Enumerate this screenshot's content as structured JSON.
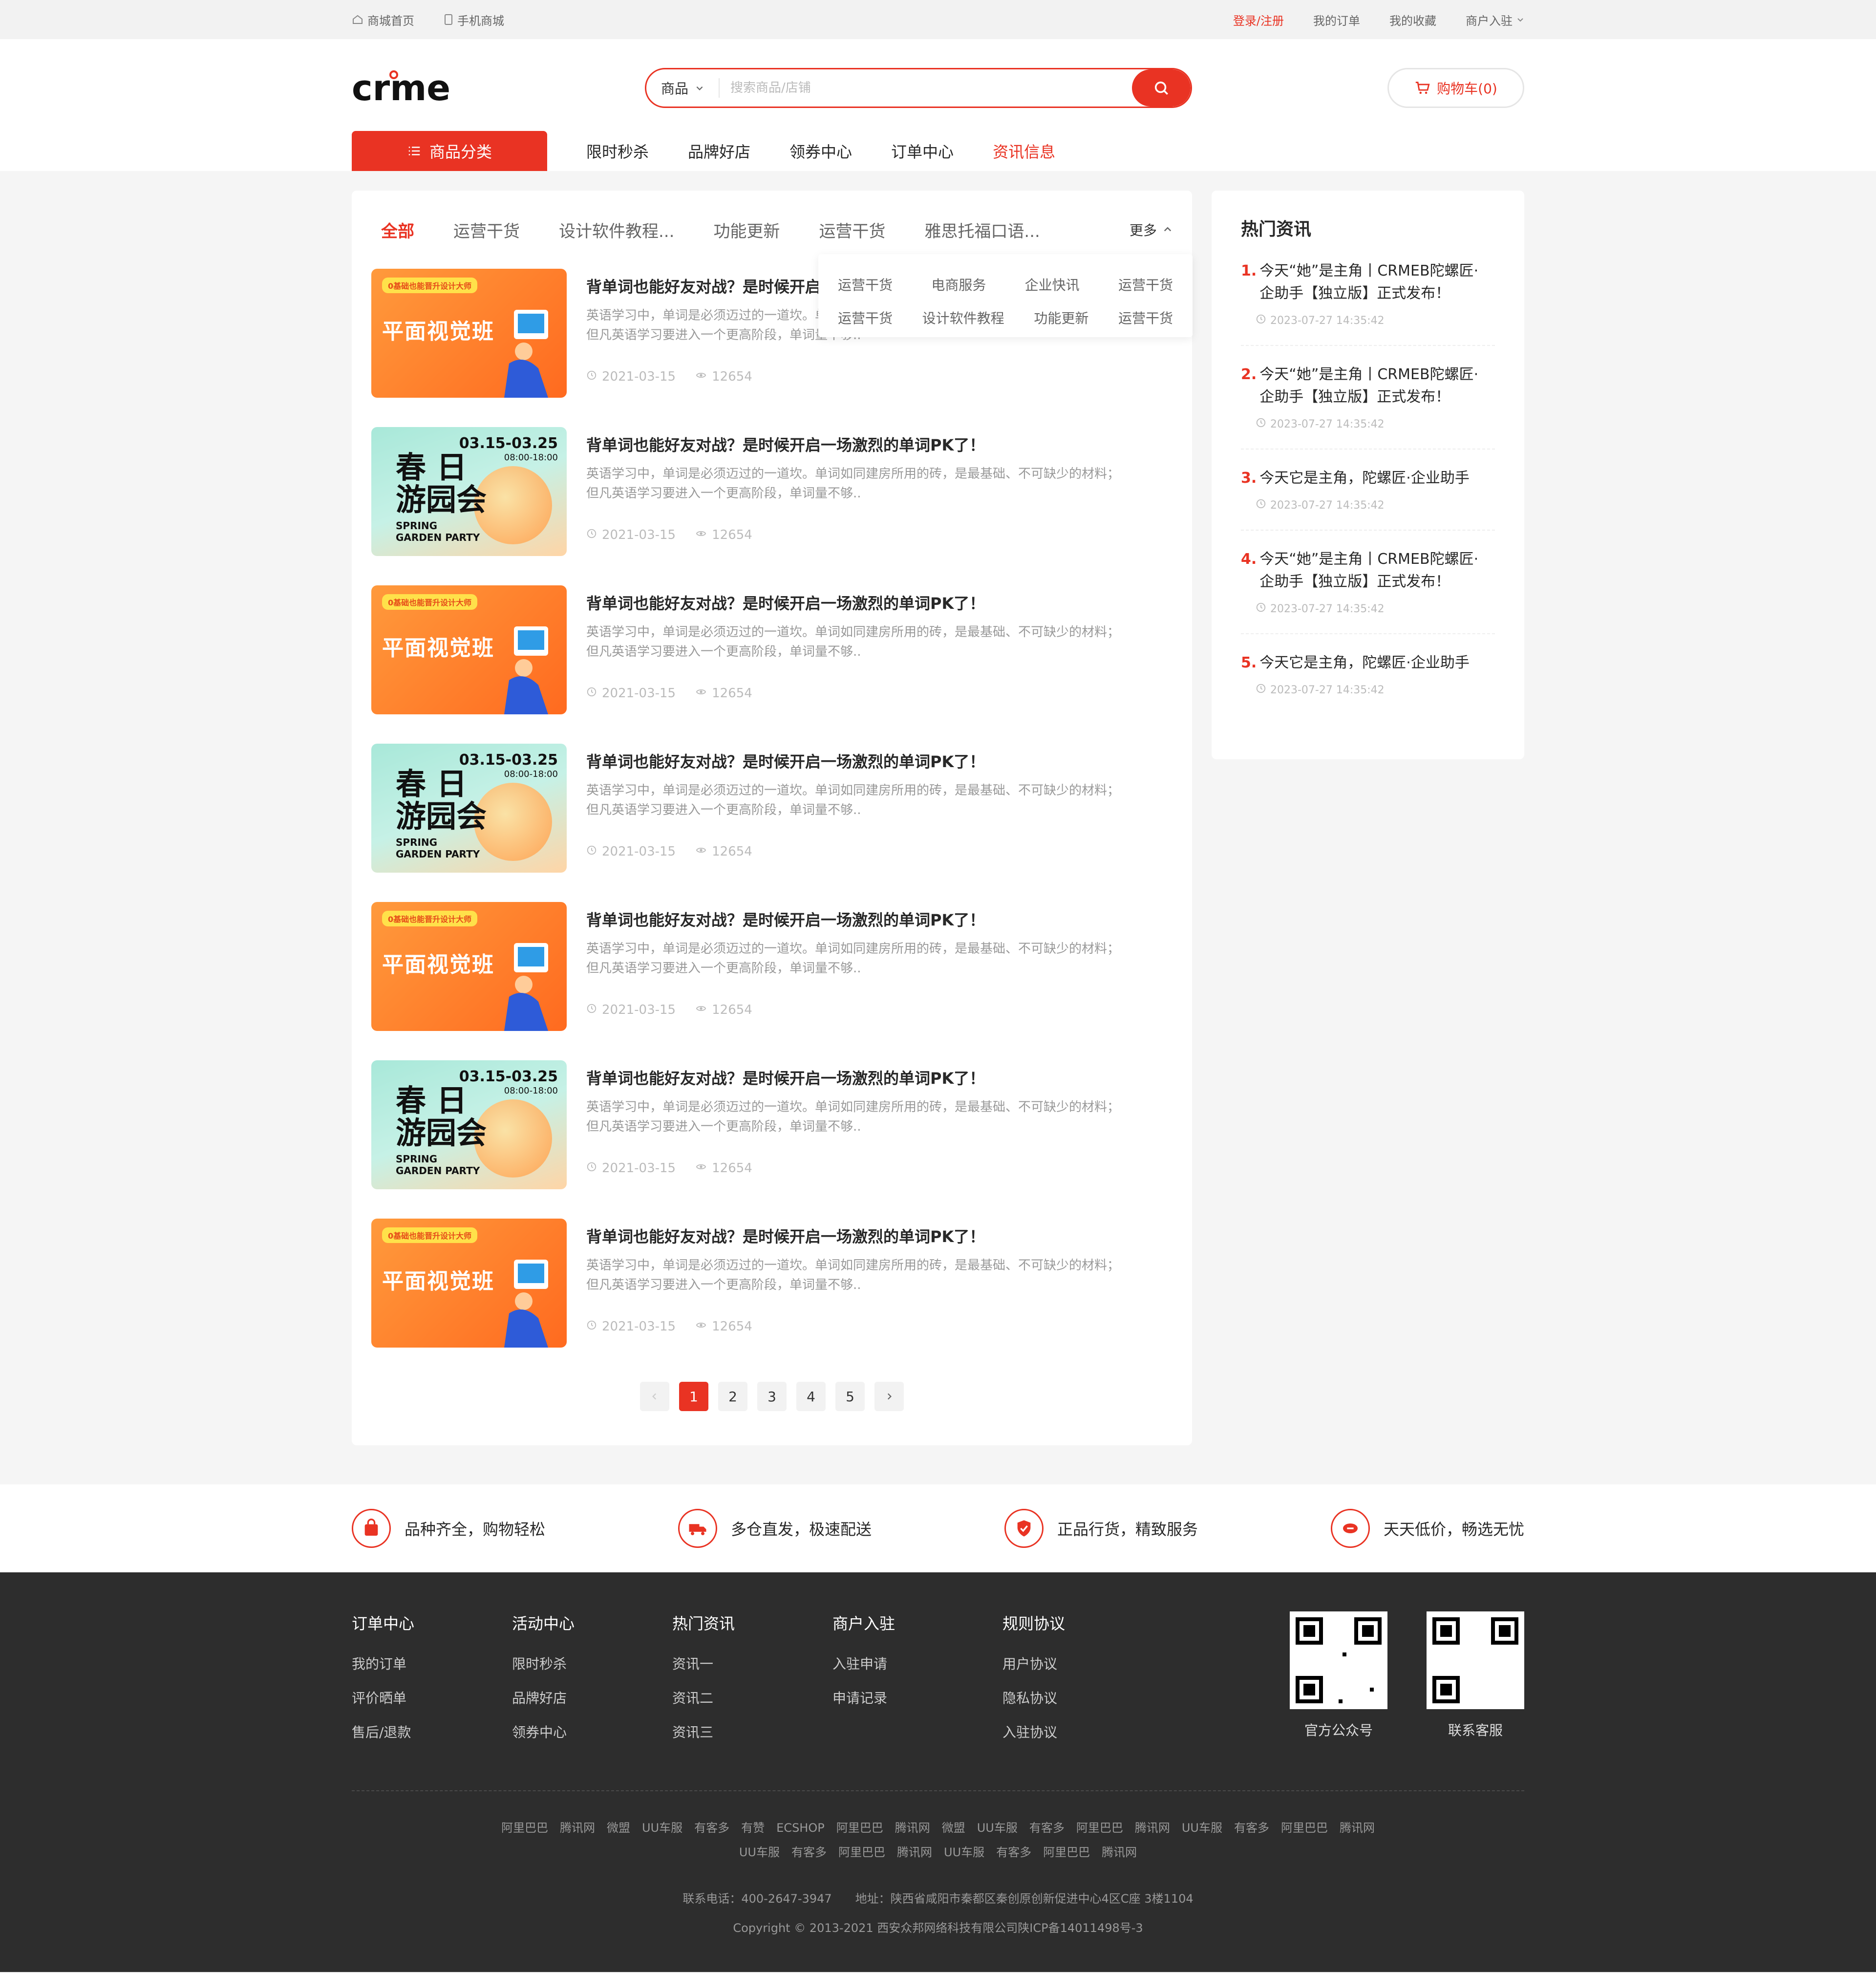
{
  "topbar": {
    "left": [
      "商城首页",
      "手机商城"
    ],
    "login": "登录/注册",
    "my_orders": "我的订单",
    "my_favorites": "我的收藏",
    "merchant": "商户入驻"
  },
  "header": {
    "logo_text": "crmeb",
    "search_type": "商品",
    "search_placeholder": "搜索商品/店铺",
    "cart_label": "购物车(0)",
    "category_button": "商品分类",
    "nav": [
      "限时秒杀",
      "品牌好店",
      "领券中心",
      "订单中心",
      "资讯信息"
    ]
  },
  "tabs": {
    "items": [
      "全部",
      "运营干货",
      "设计软件教程...",
      "功能更新",
      "运营干货",
      "雅思托福口语..."
    ],
    "more": "更多"
  },
  "dropdown": {
    "row1": [
      "运营干货",
      "电商服务",
      "企业快讯",
      "运营干货"
    ],
    "row2": [
      "运营干货",
      "设计软件教程",
      "功能更新",
      "运营干货"
    ]
  },
  "thumb_text": {
    "orange_tag": "0基础也能晋升设计大师",
    "orange_title": "平面视觉班",
    "spring_date": "03.15-03.25",
    "spring_time": "08:00-18:00",
    "spring_cn_line1": "春 日",
    "spring_cn_line2": "游园会",
    "spring_en_line1": "SPRING",
    "spring_en_line2": "GARDEN PARTY"
  },
  "articles": [
    {
      "title": "背单词也能好友对战？是时候开启",
      "desc1": "英语学习中，单词是必须迈过的一道坎。单词如同建房所用的砖，是最基础、不可缺少的材料；",
      "desc2": "但凡英语学习要进入一个更高阶段，单词量不够..",
      "date": "2021-03-15",
      "views": "12654",
      "thumb": "orange"
    },
    {
      "title": "背单词也能好友对战？是时候开启一场激烈的单词PK了！",
      "desc1": "英语学习中，单词是必须迈过的一道坎。单词如同建房所用的砖，是最基础、不可缺少的材料；",
      "desc2": "但凡英语学习要进入一个更高阶段，单词量不够..",
      "date": "2021-03-15",
      "views": "12654",
      "thumb": "spring"
    },
    {
      "title": "背单词也能好友对战？是时候开启一场激烈的单词PK了！",
      "desc1": "英语学习中，单词是必须迈过的一道坎。单词如同建房所用的砖，是最基础、不可缺少的材料；",
      "desc2": "但凡英语学习要进入一个更高阶段，单词量不够..",
      "date": "2021-03-15",
      "views": "12654",
      "thumb": "orange"
    },
    {
      "title": "背单词也能好友对战？是时候开启一场激烈的单词PK了！",
      "desc1": "英语学习中，单词是必须迈过的一道坎。单词如同建房所用的砖，是最基础、不可缺少的材料；",
      "desc2": "但凡英语学习要进入一个更高阶段，单词量不够..",
      "date": "2021-03-15",
      "views": "12654",
      "thumb": "spring"
    },
    {
      "title": "背单词也能好友对战？是时候开启一场激烈的单词PK了！",
      "desc1": "英语学习中，单词是必须迈过的一道坎。单词如同建房所用的砖，是最基础、不可缺少的材料；",
      "desc2": "但凡英语学习要进入一个更高阶段，单词量不够..",
      "date": "2021-03-15",
      "views": "12654",
      "thumb": "orange"
    },
    {
      "title": "背单词也能好友对战？是时候开启一场激烈的单词PK了！",
      "desc1": "英语学习中，单词是必须迈过的一道坎。单词如同建房所用的砖，是最基础、不可缺少的材料；",
      "desc2": "但凡英语学习要进入一个更高阶段，单词量不够..",
      "date": "2021-03-15",
      "views": "12654",
      "thumb": "spring"
    },
    {
      "title": "背单词也能好友对战？是时候开启一场激烈的单词PK了！",
      "desc1": "英语学习中，单词是必须迈过的一道坎。单词如同建房所用的砖，是最基础、不可缺少的材料；",
      "desc2": "但凡英语学习要进入一个更高阶段，单词量不够..",
      "date": "2021-03-15",
      "views": "12654",
      "thumb": "orange"
    }
  ],
  "pagination": {
    "pages": [
      "1",
      "2",
      "3",
      "4",
      "5"
    ],
    "current": "1"
  },
  "hot_news": {
    "title": "热门资讯",
    "items": [
      {
        "num": "1.",
        "line1": "今天“她”是主角丨CRMEB陀螺匠·",
        "line2": "企助手【独立版】正式发布！",
        "time": "2023-07-27 14:35:42"
      },
      {
        "num": "2.",
        "line1": "今天“她”是主角丨CRMEB陀螺匠·",
        "line2": "企助手【独立版】正式发布！",
        "time": "2023-07-27 14:35:42"
      },
      {
        "num": "3.",
        "line1": "今天它是主角，陀螺匠·企业助手",
        "line2": "",
        "time": "2023-07-27 14:35:42"
      },
      {
        "num": "4.",
        "line1": "今天“她”是主角丨CRMEB陀螺匠·",
        "line2": "企助手【独立版】正式发布！",
        "time": "2023-07-27 14:35:42"
      },
      {
        "num": "5.",
        "line1": "今天它是主角，陀螺匠·企业助手",
        "line2": "",
        "time": "2023-07-27 14:35:42"
      }
    ]
  },
  "features": [
    "品种齐全，购物轻松",
    "多仓直发，极速配送",
    "正品行货，精致服务",
    "天天低价，畅选无忧"
  ],
  "footer": {
    "columns": [
      {
        "title": "订单中心",
        "links": [
          "我的订单",
          "评价晒单",
          "售后/退款"
        ]
      },
      {
        "title": "活动中心",
        "links": [
          "限时秒杀",
          "品牌好店",
          "领券中心"
        ]
      },
      {
        "title": "热门资讯",
        "links": [
          "资讯一",
          "资讯二",
          "资讯三"
        ]
      },
      {
        "title": "商户入驻",
        "links": [
          "入驻申请",
          "申请记录"
        ]
      },
      {
        "title": "规则协议",
        "links": [
          "用户协议",
          "隐私协议",
          "入驻协议"
        ]
      }
    ],
    "qr": [
      "官方公众号",
      "联系客服"
    ],
    "links_row1": [
      "阿里巴巴",
      "腾讯网",
      "微盟",
      "UU车服",
      "有客多",
      "有赞",
      "ECSHOP",
      "阿里巴巴",
      "腾讯网",
      "微盟",
      "UU车服",
      "有客多",
      "阿里巴巴",
      "腾讯网",
      "UU车服",
      "有客多",
      "阿里巴巴",
      "腾讯网"
    ],
    "links_row2": [
      "UU车服",
      "有客多",
      "阿里巴巴",
      "腾讯网",
      "UU车服",
      "有客多",
      "阿里巴巴",
      "腾讯网"
    ],
    "contact": "联系电话：400-2647-3947　　地址：陕西省咸阳市秦都区秦创原创新促进中心4区C座 3楼1104",
    "copyright": "Copyright © 2013-2021 西安众邦网络科技有限公司陕ICP备14011498号-3"
  },
  "colors": {
    "accent": "#e93323",
    "footer_bg": "#2d2d2d"
  }
}
